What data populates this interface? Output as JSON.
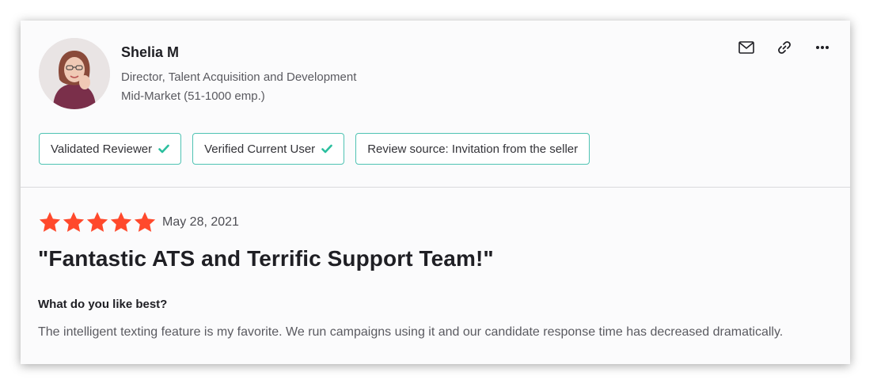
{
  "reviewer": {
    "name": "Shelia M",
    "title": "Director, Talent Acquisition and Development",
    "segment": "Mid-Market (51-1000 emp.)"
  },
  "actions": [
    {
      "icon": "mail-icon"
    },
    {
      "icon": "link-icon"
    },
    {
      "icon": "more-icon"
    }
  ],
  "badges": [
    {
      "label": "Validated Reviewer",
      "checked": true
    },
    {
      "label": "Verified Current User",
      "checked": true
    },
    {
      "label": "Review source: Invitation from the seller",
      "checked": false
    }
  ],
  "review": {
    "rating": 5,
    "rating_max": 5,
    "star_color": "#ff492c",
    "date": "May 28, 2021",
    "title": "\"Fantastic ATS and Terrific Support Team!\"",
    "question": "What do you like best?",
    "answer": "The intelligent texting feature is my favorite. We run campaigns using it and our candidate response time has decreased dramatically."
  },
  "colors": {
    "badge_border": "#4fc3b3",
    "check": "#2bbf9e"
  }
}
